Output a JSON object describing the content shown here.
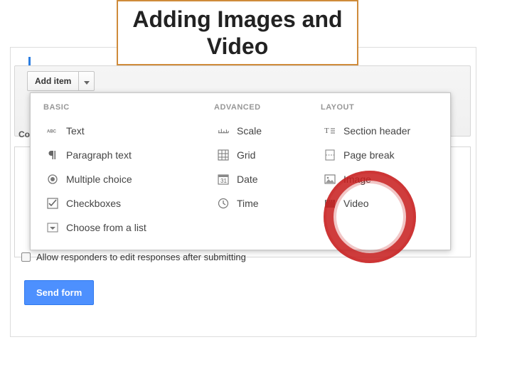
{
  "title": "Adding Images and Video",
  "toolbar": {
    "add_item_label": "Add item"
  },
  "confirmation_prefix": "Co",
  "allow_edit_label": "Allow responders to edit responses after submitting",
  "send_label": "Send form",
  "panel": {
    "columns": {
      "basic": {
        "heading": "BASIC",
        "items": [
          "Text",
          "Paragraph text",
          "Multiple choice",
          "Checkboxes",
          "Choose from a list"
        ]
      },
      "advanced": {
        "heading": "ADVANCED",
        "items": [
          "Scale",
          "Grid",
          "Date",
          "Time"
        ]
      },
      "layout": {
        "heading": "LAYOUT",
        "items": [
          "Section header",
          "Page break",
          "Image",
          "Video"
        ]
      }
    }
  }
}
